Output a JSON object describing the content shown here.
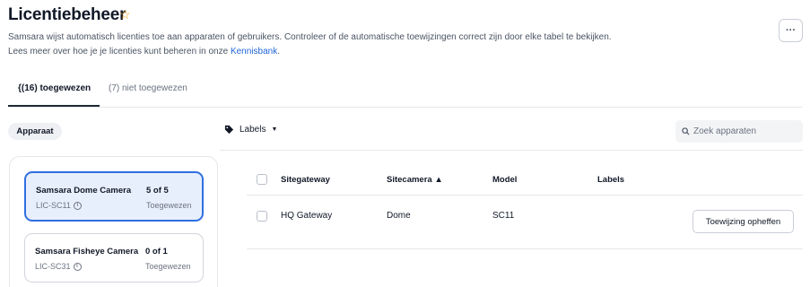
{
  "header": {
    "title": "Licentiebeheer",
    "description_line1": "Samsara wijst automatisch licenties toe aan apparaten of gebruikers. Controleer of de automatische toewijzingen correct zijn door elke tabel te bekijken.",
    "description_line2_prefix": "Lees meer over hoe je je licenties kunt beheren in onze ",
    "knowledge_link": "Kennisbank",
    "description_line2_suffix": ".",
    "more_label": "···"
  },
  "tabs": [
    {
      "label": "{(16) toegewezen",
      "active": true
    },
    {
      "label": "(7) niet toegewezen",
      "active": false
    }
  ],
  "filter_chip": "Apparaat",
  "toolbar": {
    "labels_button": "Labels",
    "search_placeholder": "Zoek apparaten"
  },
  "license_cards": [
    {
      "name": "Samsara Dome Camera",
      "code": "LIC-SC11",
      "count": "5 of 5",
      "status": "Toegewezen",
      "selected": true
    },
    {
      "name": "Samsara Fisheye Camera",
      "code": "LIC-SC31",
      "count": "0 of 1",
      "status": "Toegewezen",
      "selected": false
    }
  ],
  "table": {
    "columns": [
      "Sitegateway",
      "Sitecamera ▲",
      "Model",
      "Labels"
    ],
    "rows": [
      {
        "gateway": "HQ Gateway",
        "camera": "Dome",
        "model": "SC11",
        "labels": "",
        "action": "Toewijzing opheffen"
      }
    ]
  },
  "colors": {
    "accent": "#2f6fe0",
    "star": "#f59e0b",
    "link": "#1e64d8"
  }
}
